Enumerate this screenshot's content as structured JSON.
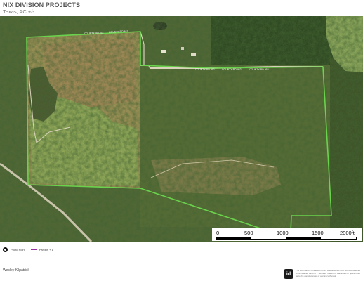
{
  "header": {
    "title": "NIX DIVISION PROJECTS",
    "subtitle": "Texas, AC +/-"
  },
  "map": {
    "boundary_color": "#6ad34d",
    "road_labels": [
      "COUNTY RD 462",
      "COUNTY RD 462",
      "COUNTY RD 462",
      "COUNTY RD 462",
      "COUNTY RD 462"
    ]
  },
  "scalebar": {
    "labels": [
      "0",
      "500",
      "1000",
      "1500",
      "2000ft"
    ]
  },
  "legend": {
    "items": [
      {
        "label": "Photo Point",
        "icon": "camera-icon"
      },
      {
        "label": "Parcels + 1",
        "color": "#9c2fa3"
      }
    ]
  },
  "footer": {
    "agent_name": "Wesley Kilpatrick",
    "logo_text": "id",
    "disclaimer": "The information contained herein was obtained from sources deemed to be reliable. Land id™ Services makes no warranties or guarantees as to the completeness or accuracy thereof."
  }
}
